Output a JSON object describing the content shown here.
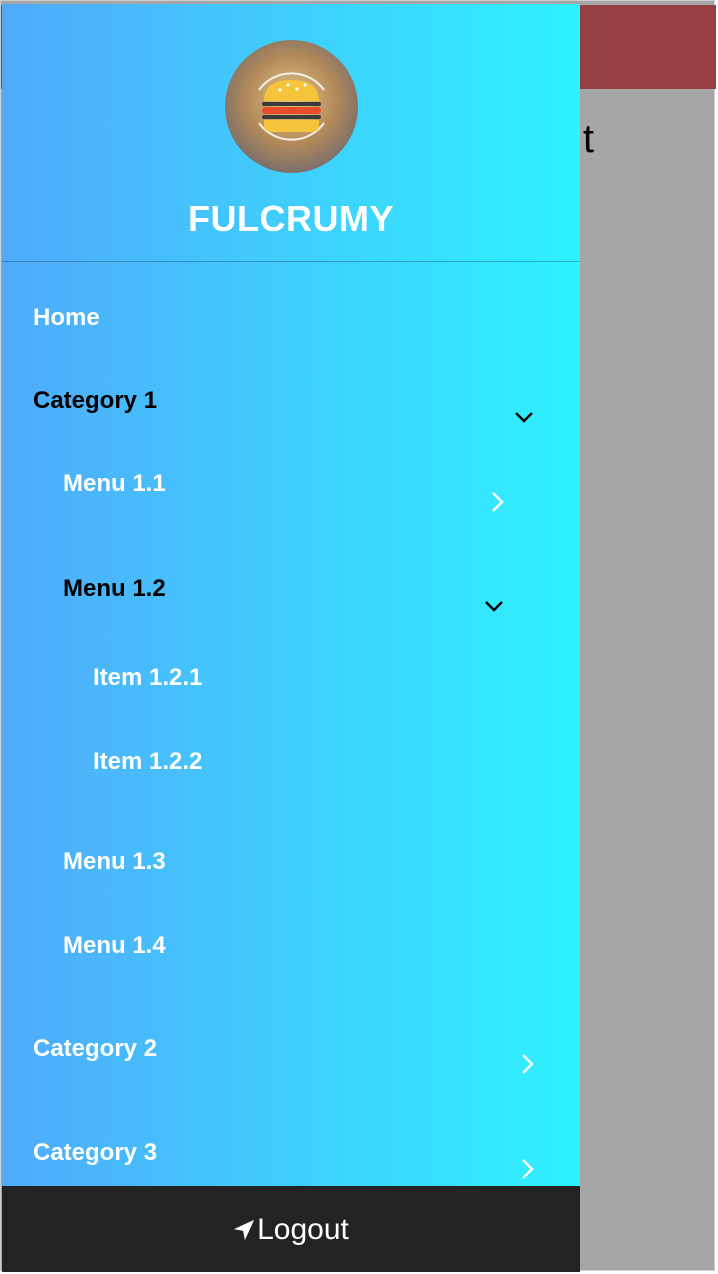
{
  "app": {
    "background_title": "t"
  },
  "drawer": {
    "brand": "FULCRUMY",
    "avatar_icon": "burger-icon",
    "items": [
      {
        "label": "Home"
      },
      {
        "label": "Category 1",
        "expanded": true
      },
      {
        "label": "Menu 1.1",
        "expanded": false
      },
      {
        "label": "Menu 1.2",
        "expanded": true
      },
      {
        "label": "Item 1.2.1"
      },
      {
        "label": "Item 1.2.2"
      },
      {
        "label": "Menu 1.3"
      },
      {
        "label": "Menu 1.4"
      },
      {
        "label": "Category 2",
        "expanded": false
      },
      {
        "label": "Category 3",
        "expanded": false
      }
    ],
    "logout_label": "Logout",
    "logout_icon": "send-icon"
  },
  "colors": {
    "gradient_start": "#50aafa",
    "gradient_end": "#2ef2ff",
    "header_bar": "#963f44",
    "footer": "#232323",
    "overlay": "#a6a6a6"
  }
}
